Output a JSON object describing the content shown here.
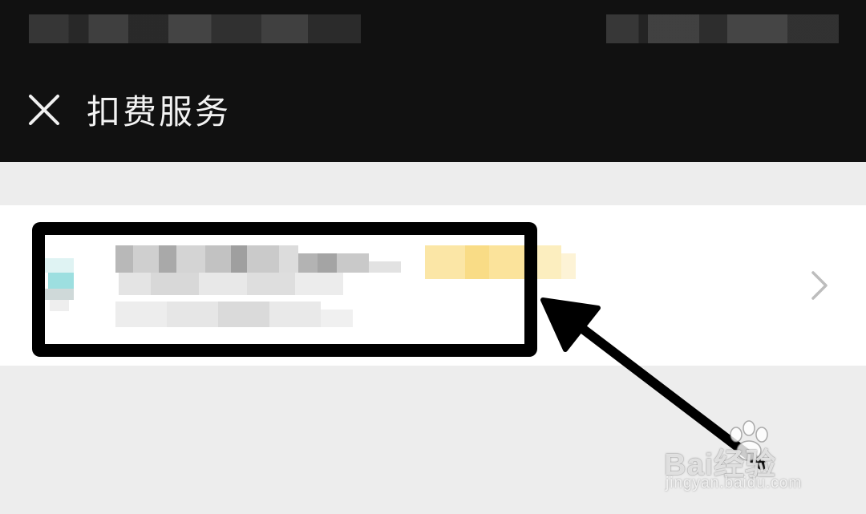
{
  "nav": {
    "title": "扣费服务"
  },
  "icons": {
    "close": "close-icon",
    "chevron": "chevron-right-icon",
    "service": "service-logo-icon",
    "arrow": "pointer-arrow",
    "paw": "paw-icon"
  },
  "watermark": {
    "brand": "Bai经验",
    "url": "jingyan.baidu.com"
  },
  "colors": {
    "top_bar": "#111111",
    "page_bg": "#ededed",
    "row_bg": "#ffffff",
    "highlight": "#000000",
    "badge": "#f7d36a"
  }
}
